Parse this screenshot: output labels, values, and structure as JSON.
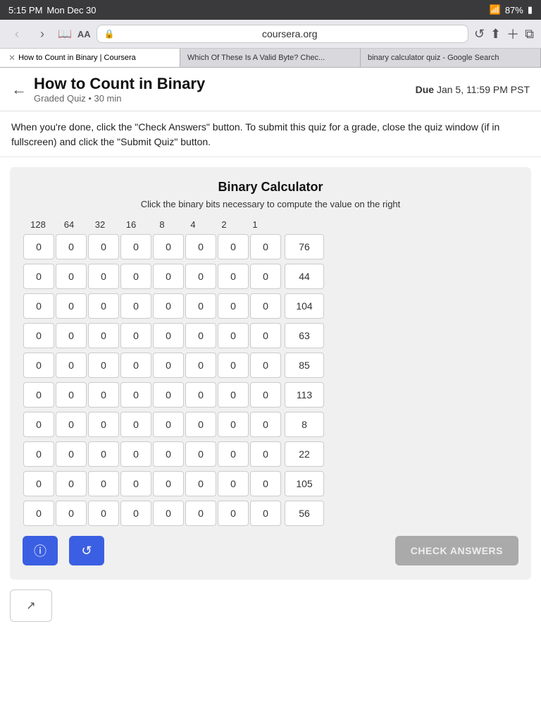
{
  "statusBar": {
    "time": "5:15 PM",
    "day": "Mon Dec 30",
    "wifi": "87%",
    "battery": "🔋"
  },
  "browser": {
    "addressBar": "coursera.org",
    "tabs": [
      {
        "id": "tab1",
        "label": "How to Count in Binary | Coursera",
        "active": true
      },
      {
        "id": "tab2",
        "label": "Which Of These Is A Valid Byte? Chec...",
        "active": false
      },
      {
        "id": "tab3",
        "label": "binary calculator quiz - Google Search",
        "active": false
      }
    ]
  },
  "page": {
    "title": "How to Count in Binary",
    "subtitle": "Graded Quiz • 30 min",
    "dueLabel": "Due",
    "dueDate": "Jan 5, 11:59 PM PST",
    "instructions": "When you're done, click the \"Check Answers\" button. To submit this quiz for a grade, close the quiz window (if in fullscreen) and click the \"Submit Quiz\" button."
  },
  "quiz": {
    "title": "Binary Calculator",
    "subtitle": "Click the binary bits necessary to compute the value on the right",
    "headers": [
      "128",
      "64",
      "32",
      "16",
      "8",
      "4",
      "2",
      "1"
    ],
    "rows": [
      {
        "bits": [
          0,
          0,
          0,
          0,
          0,
          0,
          0,
          0
        ],
        "result": 76
      },
      {
        "bits": [
          0,
          0,
          0,
          0,
          0,
          0,
          0,
          0
        ],
        "result": 44
      },
      {
        "bits": [
          0,
          0,
          0,
          0,
          0,
          0,
          0,
          0
        ],
        "result": 104
      },
      {
        "bits": [
          0,
          0,
          0,
          0,
          0,
          0,
          0,
          0
        ],
        "result": 63
      },
      {
        "bits": [
          0,
          0,
          0,
          0,
          0,
          0,
          0,
          0
        ],
        "result": 85
      },
      {
        "bits": [
          0,
          0,
          0,
          0,
          0,
          0,
          0,
          0
        ],
        "result": 113
      },
      {
        "bits": [
          0,
          0,
          0,
          0,
          0,
          0,
          0,
          0
        ],
        "result": 8
      },
      {
        "bits": [
          0,
          0,
          0,
          0,
          0,
          0,
          0,
          0
        ],
        "result": 22
      },
      {
        "bits": [
          0,
          0,
          0,
          0,
          0,
          0,
          0,
          0
        ],
        "result": 105
      },
      {
        "bits": [
          0,
          0,
          0,
          0,
          0,
          0,
          0,
          0
        ],
        "result": 56
      }
    ],
    "buttons": {
      "info": "ⓘ",
      "reset": "↺",
      "checkAnswers": "CHECK ANSWERS"
    }
  },
  "fullscreenBtn": "↗"
}
